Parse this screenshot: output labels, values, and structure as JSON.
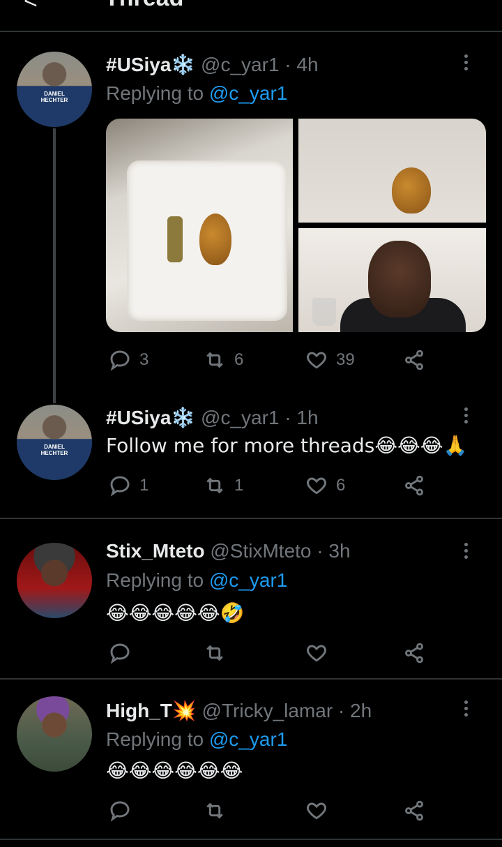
{
  "header": {
    "back_glyph": "<",
    "title": "Thread"
  },
  "tweets": [
    {
      "name": "#USiya❄️",
      "handle": "@c_yar1",
      "time": "4h",
      "replying_label": "Replying to",
      "replying_to": "@c_yar1",
      "avatar_shirt_text": "DANIEL HECHTER",
      "replies": "3",
      "retweets": "6",
      "likes": "39"
    },
    {
      "name": "#USiya❄️",
      "handle": "@c_yar1",
      "time": "1h",
      "text": "Follow me for more threads😂😂😂🙏",
      "avatar_shirt_text": "DANIEL HECHTER",
      "replies": "1",
      "retweets": "1",
      "likes": "6"
    },
    {
      "name": "Stix_Mteto",
      "handle": "@StixMteto",
      "time": "3h",
      "replying_label": "Replying to",
      "replying_to": "@c_yar1",
      "text": "😂😂😂😂😂🤣"
    },
    {
      "name": "High_T💥",
      "handle": "@Tricky_lamar",
      "time": "2h",
      "replying_label": "Replying to",
      "replying_to": "@c_yar1",
      "text": "😂😂😂😂😂😂"
    }
  ],
  "separator": "·",
  "icons": {
    "back": "back-arrow-icon",
    "reply": "reply-icon",
    "retweet": "retweet-icon",
    "like": "like-icon",
    "share": "share-icon",
    "more": "more-icon"
  },
  "colors": {
    "background": "#000000",
    "link": "#1d9bf0",
    "muted": "#71767b",
    "text": "#e7e9ea"
  }
}
